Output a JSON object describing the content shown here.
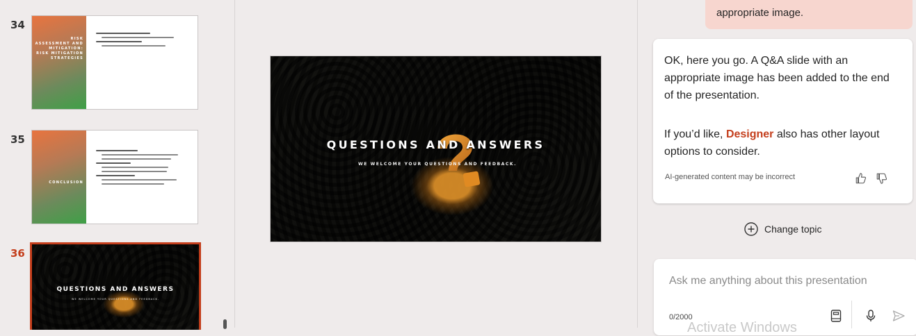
{
  "thumbnails": [
    {
      "number": "34",
      "title": "RISK ASSESSMENT AND MITIGATION: RISK MITIGATION STRATEGIES"
    },
    {
      "number": "35",
      "title": "CONCLUSION"
    },
    {
      "number": "36",
      "title": "QUESTIONS AND ANSWERS",
      "subtitle": "WE WELCOME YOUR QUESTIONS AND FEEDBACK."
    }
  ],
  "slide": {
    "title": "QUESTIONS AND ANSWERS",
    "subtitle": "WE WELCOME YOUR QUESTIONS AND FEEDBACK."
  },
  "copilot": {
    "user_message_tail": "appropriate image.",
    "reply_line1": "OK, here you go. A Q&A slide with an appropriate image has been added to the end of the presentation.",
    "reply_line2_prefix": "If you’d like, ",
    "reply_line2_link": "Designer",
    "reply_line2_suffix": " also has other layout options to consider.",
    "disclaimer": "AI-generated content may be incorrect",
    "change_topic": "Change topic",
    "input_placeholder": "Ask me anything about this presentation",
    "char_count": "0/2000",
    "watermark": "Activate Windows"
  },
  "colors": {
    "accent": "#c43e1c",
    "user_bubble": "#f7d6cf",
    "background": "#efebeb"
  },
  "icons": [
    "thumbs-up-icon",
    "thumbs-down-icon",
    "add-circle-icon",
    "notebook-icon",
    "microphone-icon",
    "send-icon"
  ]
}
